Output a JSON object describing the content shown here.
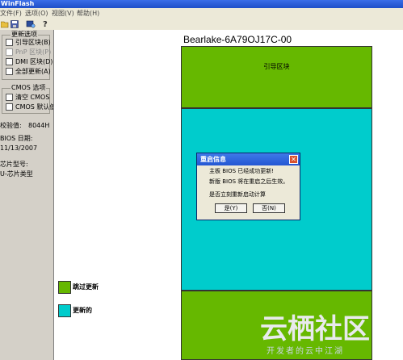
{
  "window": {
    "title": "WinFlash"
  },
  "menu": {
    "file": "文件(F)",
    "options": "选项(O)",
    "view": "视图(V)",
    "help": "帮助(H)"
  },
  "toolbar": {
    "open_icon": "folder-open-icon",
    "save_icon": "save-icon",
    "flash_icon": "flash-chip-icon",
    "help_icon": "help-icon"
  },
  "update_options": {
    "title": "更新选项",
    "items": [
      {
        "label": "引导区块(B)",
        "checked": false,
        "enabled": true
      },
      {
        "label": "PnP 区块(P)",
        "checked": false,
        "enabled": false
      },
      {
        "label": "DMI 区块(D)",
        "checked": false,
        "enabled": true
      },
      {
        "label": "全部更新(A)",
        "checked": false,
        "enabled": true
      }
    ]
  },
  "cmos_options": {
    "title": "CMOS 选项",
    "items": [
      {
        "label": "清空 CMOS",
        "checked": false
      },
      {
        "label": "CMOS 默认值",
        "checked": false
      }
    ]
  },
  "info": {
    "checksum_label": "校验值:",
    "checksum_value": "8044H",
    "bios_date_label": "BIOS 日期:",
    "bios_date_value": "11/13/2007",
    "chip_label": "芯片型号:",
    "chip_value": "U-芯片类型"
  },
  "map": {
    "title": "Bearlake-6A79OJ17C-00",
    "boot_block_label": "引导区块"
  },
  "legend": {
    "skip_label": "跳过更新",
    "updated_label": "更新的"
  },
  "dialog": {
    "title": "重启信息",
    "line1": "主板 BIOS 已经成功更新!",
    "line2": "新版 BIOS 将在重启之后生效。",
    "line3": "是否立刻重新启动计算",
    "yes_label": "是(Y)",
    "no_label": "否(N)",
    "close_glyph": "✕"
  },
  "watermark": {
    "text": "云栖社区",
    "sub": "开发者的云中江湖"
  },
  "colors": {
    "skip": "#66b800",
    "updated": "#00cccc",
    "dialog_title": "#2456d3"
  }
}
